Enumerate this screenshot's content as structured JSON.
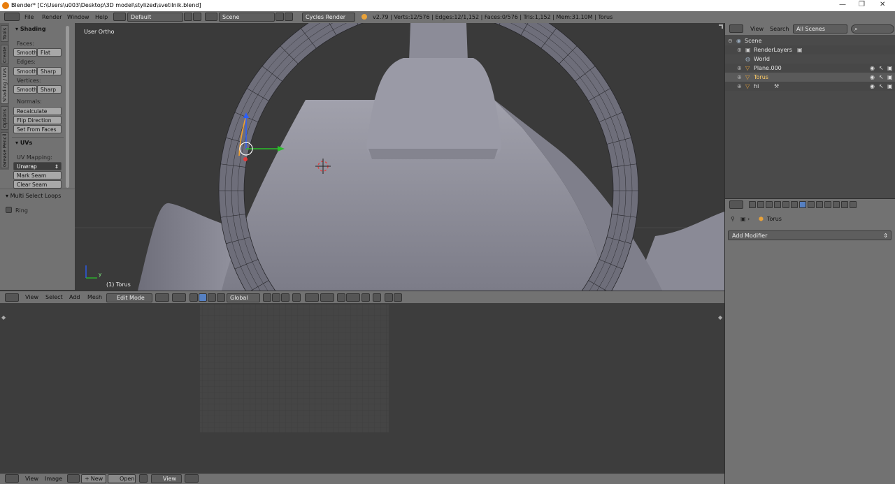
{
  "window": {
    "title": "Blender* [C:\\Users\\u003\\Desktop\\3D model\\stylized\\svetilnik.blend]",
    "minimize": "—",
    "restore": "❐",
    "close": "✕"
  },
  "info_header": {
    "menus": [
      "File",
      "Render",
      "Window",
      "Help"
    ],
    "layout": "Default",
    "scene": "Scene",
    "render_engine": "Cycles Render",
    "stats": "v2.79 | Verts:12/576 | Edges:12/1,152 | Faces:0/576 | Tris:1,152 | Mem:31.10M | Torus"
  },
  "tool_tabs": [
    "Tools",
    "Create",
    "Shading / UVs",
    "Options",
    "Grease Pencil"
  ],
  "tool_shelf": {
    "shading": {
      "title": "Shading",
      "faces_label": "Faces:",
      "edges_label": "Edges:",
      "vertices_label": "Vertices:",
      "smooth": "Smooth",
      "flat": "Flat",
      "sharp": "Sharp",
      "normals_label": "Normals:",
      "recalculate": "Recalculate",
      "flip_direction": "Flip Direction",
      "set_from_faces": "Set From Faces"
    },
    "uvs": {
      "title": "UVs",
      "uv_mapping_label": "UV Mapping:",
      "unwrap": "Unwrap",
      "mark_seam": "Mark Seam",
      "clear_seam": "Clear Seam"
    },
    "multi_select": {
      "title": "Multi Select Loops",
      "ring": "Ring",
      "ring_checked": false
    }
  },
  "viewport": {
    "view_label": "User Ortho",
    "object_label": "(1) Torus",
    "axis_y": "y"
  },
  "view3d_header": {
    "menus": [
      "View",
      "Select",
      "Add",
      "Mesh"
    ],
    "mode": "Edit Mode",
    "orientation": "Global"
  },
  "uv_header": {
    "menus": [
      "View",
      "Image"
    ],
    "new": "New",
    "open": "Open",
    "view": "View"
  },
  "outliner": {
    "menus": [
      "View",
      "Search"
    ],
    "filter": "All Scenes",
    "items": [
      {
        "name": "Scene",
        "indent": 0
      },
      {
        "name": "RenderLayers",
        "indent": 1
      },
      {
        "name": "World",
        "indent": 1
      },
      {
        "name": "Plane.000",
        "indent": 1
      },
      {
        "name": "Torus",
        "indent": 1
      },
      {
        "name": "hi",
        "indent": 1
      }
    ]
  },
  "properties": {
    "object_name": "Torus",
    "add_modifier": "Add Modifier"
  },
  "colors": {
    "panel": "#727272",
    "viewport_bg": "#3a3a3a",
    "mesh": "#8e8e9a",
    "x_axis": "#2bbf2b",
    "y_axis": "#2a5fff",
    "z_axis": "#e23a3a",
    "selected": "#5680c2"
  }
}
